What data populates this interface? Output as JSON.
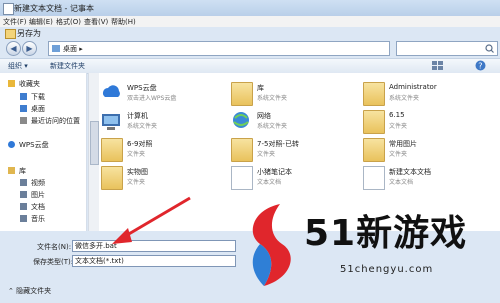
{
  "notepad": {
    "title": "新建文本文档 - 记事本",
    "menu": [
      "文件(F)",
      "编辑(E)",
      "格式(O)",
      "查看(V)",
      "帮助(H)"
    ]
  },
  "dialog": {
    "title": "另存为",
    "address": "桌面",
    "toolbar": {
      "organize": "组织 ▾",
      "new_folder": "新建文件夹"
    },
    "sidebar": [
      {
        "label": "收藏夹",
        "icon": "star-icon",
        "color": "#e9b73a"
      },
      {
        "label": "下载",
        "icon": "download-icon",
        "color": "#3f7dcf"
      },
      {
        "label": "桌面",
        "icon": "desktop-icon",
        "color": "#3f7dcf"
      },
      {
        "label": "最近访问的位置",
        "icon": "recent-icon",
        "color": "#8a8a8a"
      },
      {
        "label": "WPS云盘",
        "icon": "cloud-icon",
        "color": "#2f79d8"
      },
      {
        "label": "库",
        "icon": "library-icon",
        "color": "#e0b64f"
      },
      {
        "label": "视频",
        "icon": "video-icon",
        "color": "#6b7f9a"
      },
      {
        "label": "图片",
        "icon": "picture-icon",
        "color": "#6b7f9a"
      },
      {
        "label": "文档",
        "icon": "documents-icon",
        "color": "#6b7f9a"
      },
      {
        "label": "音乐",
        "icon": "music-icon",
        "color": "#6b7f9a"
      }
    ],
    "items": [
      {
        "name": "WPS云盘",
        "sub": "双击进入WPS云盘",
        "kind": "wps"
      },
      {
        "name": "库",
        "sub": "系统文件夹",
        "kind": "folder"
      },
      {
        "name": "Administrator",
        "sub": "系统文件夹",
        "kind": "user"
      },
      {
        "name": "计算机",
        "sub": "系统文件夹",
        "kind": "computer"
      },
      {
        "name": "网络",
        "sub": "系统文件夹",
        "kind": "network"
      },
      {
        "name": "6.15",
        "sub": "文件夹",
        "kind": "folder"
      },
      {
        "name": "6-9对照",
        "sub": "文件夹",
        "kind": "folder"
      },
      {
        "name": "7-5对照-已转",
        "sub": "文件夹",
        "kind": "folder"
      },
      {
        "name": "常用图片",
        "sub": "文件夹",
        "kind": "folder"
      },
      {
        "name": "实物图",
        "sub": "文件夹",
        "kind": "folder"
      },
      {
        "name": "小猪笔记本",
        "sub": "文本文档",
        "kind": "doc"
      },
      {
        "name": "新建文本文档",
        "sub": "文本文档",
        "kind": "doc"
      }
    ],
    "filename_label": "文件名(N):",
    "filename_value": "微信多开.bat",
    "filetype_label": "保存类型(T):",
    "filetype_value": "文本文档(*.txt)",
    "hide_folders": "隐藏文件夹"
  },
  "watermark": {
    "brand": "51新游戏",
    "url": "51chengyu.com"
  },
  "colors": {
    "arrow": "#e0262c",
    "logo_red": "#e0262c",
    "logo_blue": "#2f7fd6"
  }
}
